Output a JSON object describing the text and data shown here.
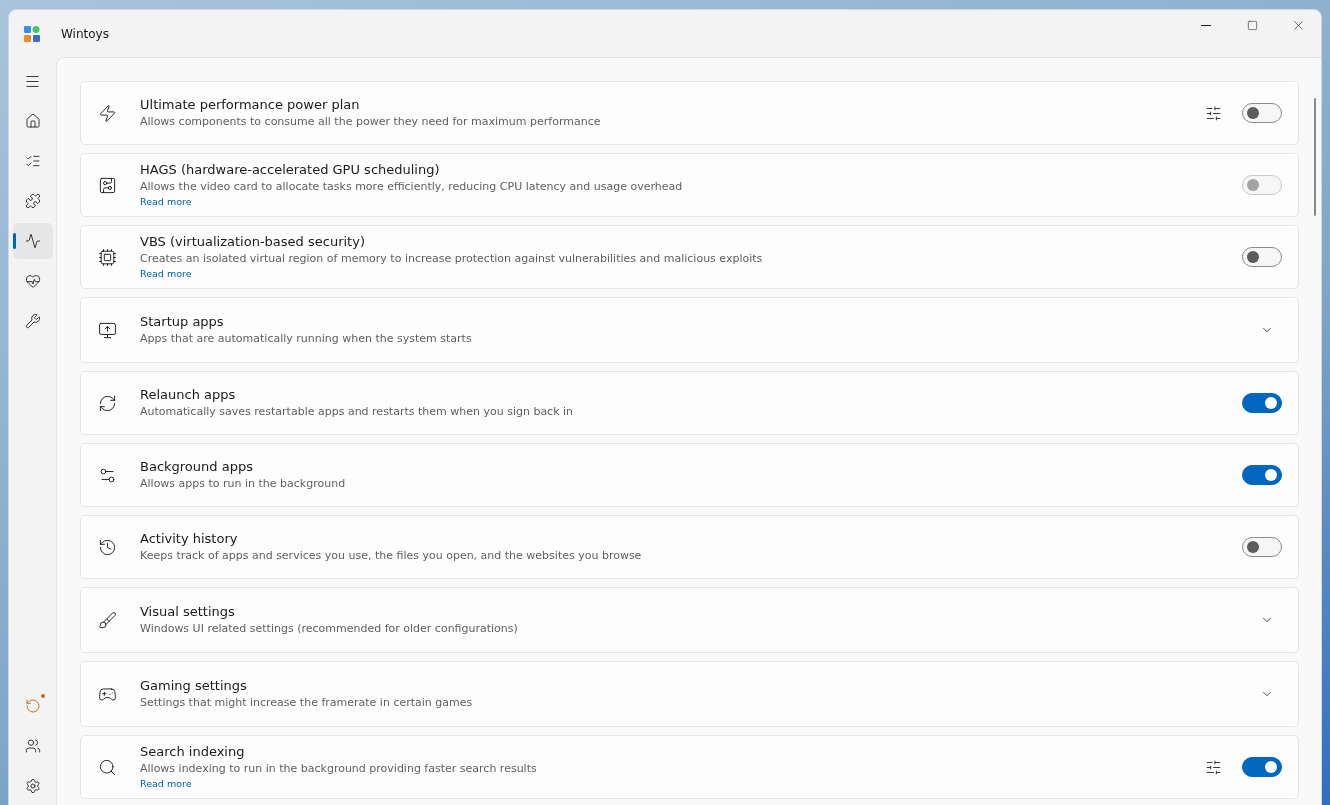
{
  "window": {
    "title": "Wintoys"
  },
  "sidebar": {
    "items": [
      {
        "selected": false
      },
      {
        "selected": false
      },
      {
        "selected": false
      },
      {
        "selected": true
      },
      {
        "selected": false
      },
      {
        "selected": false
      }
    ],
    "bottom_items": [
      {
        "notification": true
      },
      {
        "notification": false
      },
      {
        "notification": false
      }
    ]
  },
  "rows": [
    {
      "kind": "toggle",
      "title": "Ultimate performance power plan",
      "description": "Allows components to consume all the power they need for maximum performance",
      "settings_button": true,
      "on": false,
      "disabled": false
    },
    {
      "kind": "toggle",
      "title": "HAGS (hardware-accelerated GPU scheduling)",
      "description": "Allows the video card to allocate tasks more efficiently, reducing CPU latency and usage overhead",
      "link": "Read more",
      "settings_button": false,
      "on": false,
      "disabled": true
    },
    {
      "kind": "toggle",
      "title": "VBS (virtualization-based security)",
      "description": "Creates an isolated virtual region of memory to increase protection against vulnerabilities and malicious exploits",
      "link": "Read more",
      "settings_button": false,
      "on": false,
      "disabled": false
    },
    {
      "kind": "expander",
      "title": "Startup apps",
      "description": "Apps that are automatically running when the system starts",
      "expanded": false
    },
    {
      "kind": "toggle",
      "title": "Relaunch apps",
      "description": "Automatically saves restartable apps and restarts them when you sign back in",
      "settings_button": false,
      "on": true,
      "disabled": false
    },
    {
      "kind": "toggle",
      "title": "Background apps",
      "description": "Allows apps to run in the background",
      "settings_button": false,
      "on": true,
      "disabled": false
    },
    {
      "kind": "toggle",
      "title": "Activity history",
      "description": "Keeps track of apps and services you use, the files you open, and the websites you browse",
      "settings_button": false,
      "on": false,
      "disabled": false
    },
    {
      "kind": "expander",
      "title": "Visual settings",
      "description": "Windows UI related settings (recommended for older configurations)",
      "expanded": false
    },
    {
      "kind": "expander",
      "title": "Gaming settings",
      "description": "Settings that might increase the framerate in certain games",
      "expanded": false
    },
    {
      "kind": "toggle",
      "title": "Search indexing",
      "description": "Allows indexing to run in the background providing faster search results",
      "link": "Read more",
      "settings_button": true,
      "on": true,
      "disabled": false
    }
  ]
}
